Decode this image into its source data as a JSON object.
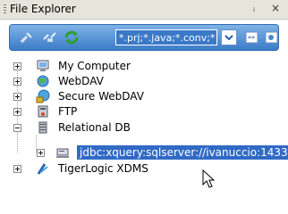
{
  "window": {
    "title": "File Explorer",
    "pin_glyph": "ᵢ",
    "close_glyph": "×"
  },
  "toolbar": {
    "filter_value": "*.prj;*.java;*.conv;*",
    "icons": [
      "connect-icon",
      "disconnect-icon",
      "refresh-icon",
      "filter-dropdown-icon",
      "filter-apply-icon",
      "options-icon"
    ]
  },
  "tree": {
    "items": [
      {
        "label": "My Computer",
        "icon": "computer-icon",
        "expander": "plus"
      },
      {
        "label": "WebDAV",
        "icon": "globe-icon",
        "expander": "plus"
      },
      {
        "label": "Secure WebDAV",
        "icon": "secure-globe-icon",
        "expander": "plus"
      },
      {
        "label": "FTP",
        "icon": "ftp-icon",
        "expander": "plus"
      },
      {
        "label": "Relational DB",
        "icon": "database-icon",
        "expander": "minus"
      },
      {
        "label": "jdbc:xquery:sqlserver://ivanuccio:1433",
        "icon": "server-connection-icon",
        "expander": "plus",
        "selected": true
      },
      {
        "label": "TigerLogic XDMS",
        "icon": "xdms-icon",
        "expander": "plus"
      }
    ]
  },
  "colors": {
    "toolbar_top": "#7fb3e6",
    "toolbar_bottom": "#3b7cc7",
    "selection": "#316ac5"
  }
}
